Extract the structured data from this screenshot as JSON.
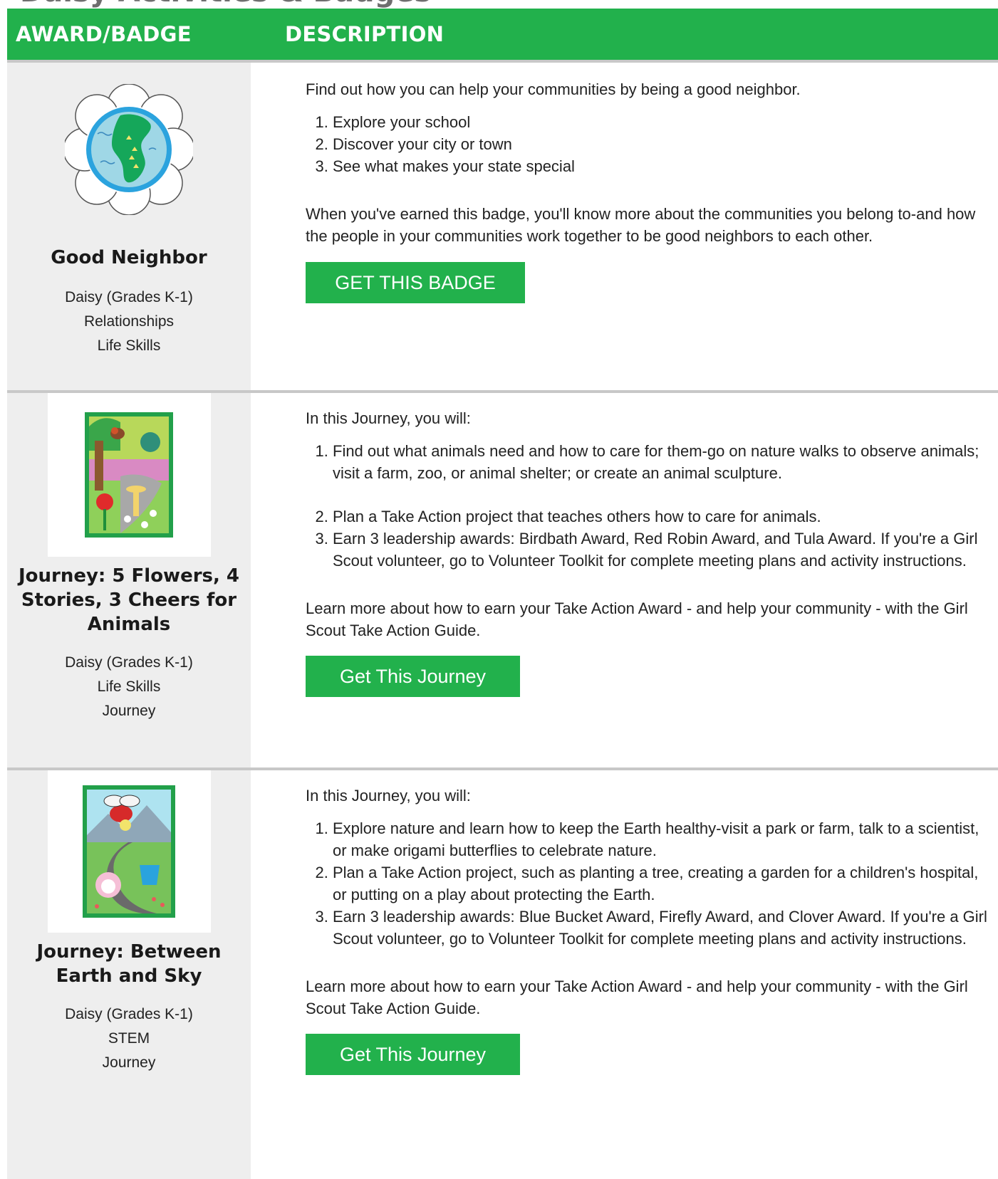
{
  "page": {
    "header_partial": "Daisy Activities & Badges",
    "table_headers": {
      "award": "AWARD/BADGE",
      "description": "DESCRIPTION"
    }
  },
  "rows": [
    {
      "title": "Good Neighbor",
      "meta": [
        "Daisy (Grades K-1)",
        "Relationships",
        "Life Skills"
      ],
      "intro": "Find out how you can help your communities by being a good neighbor.",
      "steps": [
        "Explore your school",
        "Discover your city or town",
        "See what makes your state special"
      ],
      "outro": "When you've earned this badge, you'll know more about the communities you belong to-and how the people in your communities work together to be good neighbors to each other.",
      "button": "GET THIS BADGE",
      "icon": "good-neighbor-badge-icon"
    },
    {
      "title": "Journey: 5 Flowers, 4 Stories, 3 Cheers for Animals",
      "meta": [
        "Daisy (Grades K-1)",
        "Life Skills",
        "Journey"
      ],
      "intro": "In this Journey, you will:",
      "steps": [
        "Find out what animals need and how to care for them-go on nature walks to observe animals; visit a farm, zoo, or animal shelter; or create an animal sculpture.",
        "Plan a Take Action project that teaches others how to care for animals.",
        "Earn 3 leadership awards: Birdbath Award, Red Robin Award, and Tula Award. If you're a Girl Scout volunteer, go to Volunteer Toolkit for complete meeting plans and activity instructions."
      ],
      "outro": "Learn more about how to earn your Take Action Award - and help your community - with the Girl Scout Take Action Guide.",
      "button": "Get This Journey",
      "icon": "animals-journey-book-icon"
    },
    {
      "title": "Journey: Between Earth and Sky",
      "meta": [
        "Daisy (Grades K-1)",
        "STEM",
        "Journey"
      ],
      "intro": "In this Journey, you will:",
      "steps": [
        "Explore nature and learn how to keep the Earth healthy-visit a park or farm, talk to a scientist, or make origami butterflies to celebrate nature.",
        "Plan a Take Action project, such as planting a tree, creating a garden for a children's hospital, or putting on a play about protecting the Earth.",
        "Earn 3 leadership awards: Blue Bucket Award, Firefly Award, and Clover Award. If you're a Girl Scout volunteer, go to Volunteer Toolkit for complete meeting plans and activity instructions."
      ],
      "outro": "Learn more about how to earn your Take Action Award - and help your community - with the Girl Scout Take Action Guide.",
      "button": "Get This Journey",
      "icon": "earth-sky-journey-book-icon"
    }
  ],
  "colors": {
    "accent": "#22b14c",
    "left_bg": "#eeeeee",
    "divider": "#c8c8c8"
  }
}
